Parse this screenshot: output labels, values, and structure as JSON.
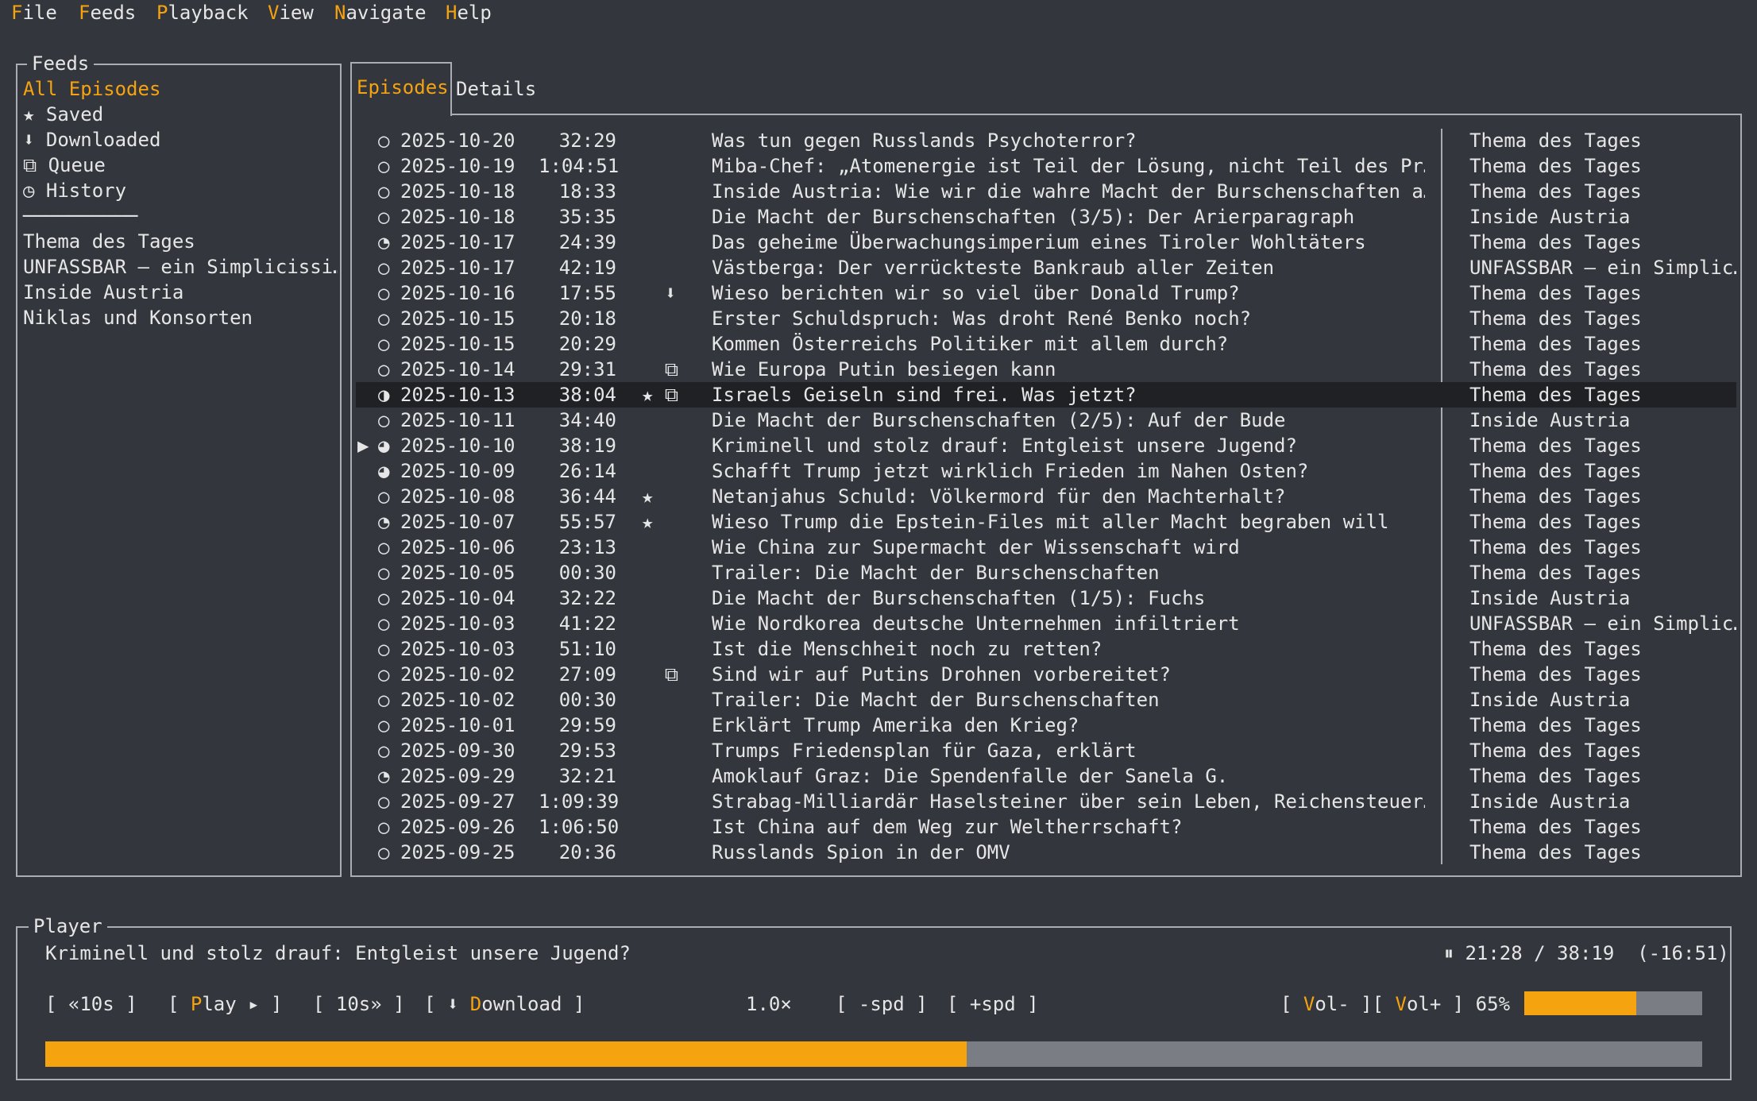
{
  "menu": [
    {
      "hot": "F",
      "rest": "ile"
    },
    {
      "hot": "F",
      "rest": "eeds"
    },
    {
      "hot": "P",
      "rest": "layback"
    },
    {
      "hot": "V",
      "rest": "iew"
    },
    {
      "hot": "N",
      "rest": "avigate"
    },
    {
      "hot": "H",
      "rest": "elp"
    }
  ],
  "sidebar": {
    "title": "Feeds",
    "items": [
      {
        "icon": "",
        "label": "All Episodes",
        "active": true
      },
      {
        "icon": "★",
        "label": "Saved"
      },
      {
        "icon": "⬇",
        "label": "Downloaded"
      },
      {
        "icon": "⧉",
        "label": "Queue"
      },
      {
        "icon": "◷",
        "label": "History"
      }
    ],
    "divider": "──────────",
    "feeds": [
      "Thema des Tages",
      "UNFASSBAR – ein Simplicissi…",
      "Inside Austria",
      "Niklas und Konsorten"
    ]
  },
  "tabs": {
    "episodes": "Episodes",
    "details": "Details"
  },
  "episodes": [
    {
      "cur": "",
      "st": "○",
      "date": "2025-10-20",
      "dur": "32:29",
      "fl": "",
      "title": "Was tun gegen Russlands Psychoterror?",
      "feed": "Thema des Tages"
    },
    {
      "cur": "",
      "st": "○",
      "date": "2025-10-19",
      "dur": "1:04:51",
      "fl": "",
      "title": "Miba-Chef: „Atomenergie ist Teil der Lösung, nicht Teil des Pr…",
      "feed": "Thema des Tages"
    },
    {
      "cur": "",
      "st": "○",
      "date": "2025-10-18",
      "dur": "18:33",
      "fl": "",
      "title": "Inside Austria: Wie wir die wahre Macht der Burschenschaften a…",
      "feed": "Thema des Tages"
    },
    {
      "cur": "",
      "st": "○",
      "date": "2025-10-18",
      "dur": "35:35",
      "fl": "",
      "title": "Die Macht der Burschenschaften (3/5): Der Arierparagraph",
      "feed": "Inside Austria"
    },
    {
      "cur": "",
      "st": "◔",
      "date": "2025-10-17",
      "dur": "24:39",
      "fl": "",
      "title": "Das geheime Überwachungsimperium eines Tiroler Wohltäters",
      "feed": "Thema des Tages"
    },
    {
      "cur": "",
      "st": "○",
      "date": "2025-10-17",
      "dur": "42:19",
      "fl": "",
      "title": "Västberga: Der verrückteste Bankraub aller Zeiten",
      "feed": "UNFASSBAR – ein Simplic…"
    },
    {
      "cur": "",
      "st": "○",
      "date": "2025-10-16",
      "dur": "17:55",
      "fl": "  ⬇",
      "title": "Wieso berichten wir so viel über Donald Trump?",
      "feed": "Thema des Tages"
    },
    {
      "cur": "",
      "st": "○",
      "date": "2025-10-15",
      "dur": "20:18",
      "fl": "",
      "title": "Erster Schuldspruch: Was droht René Benko noch?",
      "feed": "Thema des Tages"
    },
    {
      "cur": "",
      "st": "○",
      "date": "2025-10-15",
      "dur": "20:29",
      "fl": "",
      "title": "Kommen Österreichs Politiker mit allem durch?",
      "feed": "Thema des Tages"
    },
    {
      "cur": "",
      "st": "○",
      "date": "2025-10-14",
      "dur": "29:31",
      "fl": "  ⧉",
      "title": "Wie Europa Putin besiegen kann",
      "feed": "Thema des Tages"
    },
    {
      "cur": "",
      "st": "◑",
      "date": "2025-10-13",
      "dur": "38:04",
      "fl": "★ ⧉",
      "title": "Israels Geiseln sind frei. Was jetzt?",
      "feed": "Thema des Tages",
      "sel": true
    },
    {
      "cur": "",
      "st": "○",
      "date": "2025-10-11",
      "dur": "34:40",
      "fl": "",
      "title": "Die Macht der Burschenschaften (2/5): Auf der Bude",
      "feed": "Inside Austria"
    },
    {
      "cur": "▶",
      "st": "◕",
      "date": "2025-10-10",
      "dur": "38:19",
      "fl": "",
      "title": "Kriminell und stolz drauf: Entgleist unsere Jugend?",
      "feed": "Thema des Tages"
    },
    {
      "cur": "",
      "st": "◕",
      "date": "2025-10-09",
      "dur": "26:14",
      "fl": "",
      "title": "Schafft Trump jetzt wirklich Frieden im Nahen Osten?",
      "feed": "Thema des Tages"
    },
    {
      "cur": "",
      "st": "○",
      "date": "2025-10-08",
      "dur": "36:44",
      "fl": "★",
      "title": "Netanjahus Schuld: Völkermord für den Machterhalt?",
      "feed": "Thema des Tages"
    },
    {
      "cur": "",
      "st": "◔",
      "date": "2025-10-07",
      "dur": "55:57",
      "fl": "★",
      "title": "Wieso Trump die Epstein-Files mit aller Macht begraben will",
      "feed": "Thema des Tages"
    },
    {
      "cur": "",
      "st": "○",
      "date": "2025-10-06",
      "dur": "23:13",
      "fl": "",
      "title": "Wie China zur Supermacht der Wissenschaft wird",
      "feed": "Thema des Tages"
    },
    {
      "cur": "",
      "st": "○",
      "date": "2025-10-05",
      "dur": "00:30",
      "fl": "",
      "title": "Trailer: Die Macht der Burschenschaften",
      "feed": "Thema des Tages"
    },
    {
      "cur": "",
      "st": "○",
      "date": "2025-10-04",
      "dur": "32:22",
      "fl": "",
      "title": "Die Macht der Burschenschaften (1/5): Fuchs",
      "feed": "Inside Austria"
    },
    {
      "cur": "",
      "st": "○",
      "date": "2025-10-03",
      "dur": "41:22",
      "fl": "",
      "title": "Wie Nordkorea deutsche Unternehmen infiltriert",
      "feed": "UNFASSBAR – ein Simplic…"
    },
    {
      "cur": "",
      "st": "○",
      "date": "2025-10-03",
      "dur": "51:10",
      "fl": "",
      "title": "Ist die Menschheit noch zu retten?",
      "feed": "Thema des Tages"
    },
    {
      "cur": "",
      "st": "○",
      "date": "2025-10-02",
      "dur": "27:09",
      "fl": "  ⧉",
      "title": "Sind wir auf Putins Drohnen vorbereitet?",
      "feed": "Thema des Tages"
    },
    {
      "cur": "",
      "st": "○",
      "date": "2025-10-02",
      "dur": "00:30",
      "fl": "",
      "title": "Trailer: Die Macht der Burschenschaften",
      "feed": "Inside Austria"
    },
    {
      "cur": "",
      "st": "○",
      "date": "2025-10-01",
      "dur": "29:59",
      "fl": "",
      "title": "Erklärt Trump Amerika den Krieg?",
      "feed": "Thema des Tages"
    },
    {
      "cur": "",
      "st": "○",
      "date": "2025-09-30",
      "dur": "29:53",
      "fl": "",
      "title": "Trumps Friedensplan für Gaza, erklärt",
      "feed": "Thema des Tages"
    },
    {
      "cur": "",
      "st": "◔",
      "date": "2025-09-29",
      "dur": "32:21",
      "fl": "",
      "title": "Amoklauf Graz: Die Spendenfalle der Sanela G.",
      "feed": "Thema des Tages"
    },
    {
      "cur": "",
      "st": "○",
      "date": "2025-09-27",
      "dur": "1:09:39",
      "fl": "",
      "title": "Strabag-Milliardär Haselsteiner über sein Leben, Reichensteuer…",
      "feed": "Inside Austria"
    },
    {
      "cur": "",
      "st": "○",
      "date": "2025-09-26",
      "dur": "1:06:50",
      "fl": "",
      "title": "Ist China auf dem Weg zur Weltherrschaft?",
      "feed": "Thema des Tages"
    },
    {
      "cur": "",
      "st": "○",
      "date": "2025-09-25",
      "dur": "20:36",
      "fl": "",
      "title": "Russlands Spion in der OMV",
      "feed": "Thema des Tages"
    }
  ],
  "player": {
    "title": "Player",
    "now_playing": "Kriminell und stolz drauf: Entgleist unsere Jugend?",
    "pause_icon": "⏸",
    "time": "21:28 / 38:19",
    "remaining": "(-16:51)",
    "btn_back": "[ «10s ]",
    "btn_play_pre": "[ ",
    "btn_play_hot": "P",
    "btn_play_rest": "lay ▸ ]",
    "btn_fwd": "[ 10s» ]",
    "btn_dl_pre": "[ ⬇ ",
    "btn_dl_hot": "D",
    "btn_dl_rest": "ownload ]",
    "speed": "1.0×",
    "btn_spd_down": "[ -spd ]",
    "btn_spd_up": "[ +spd ]",
    "vol_minus_pre": "[ ",
    "vol_minus_hot": "V",
    "vol_minus_rest": "ol- ][ ",
    "vol_plus_hot": "V",
    "vol_plus_rest": "ol+ ]",
    "volume": "65%",
    "volume_level": 0.63,
    "progress_fraction": 0.556
  },
  "colors": {
    "accent": "#f5a30f",
    "background": "#33363d",
    "border": "#a9acb2",
    "selected_row": "#1f2125",
    "bar_track": "#7a7d83"
  }
}
